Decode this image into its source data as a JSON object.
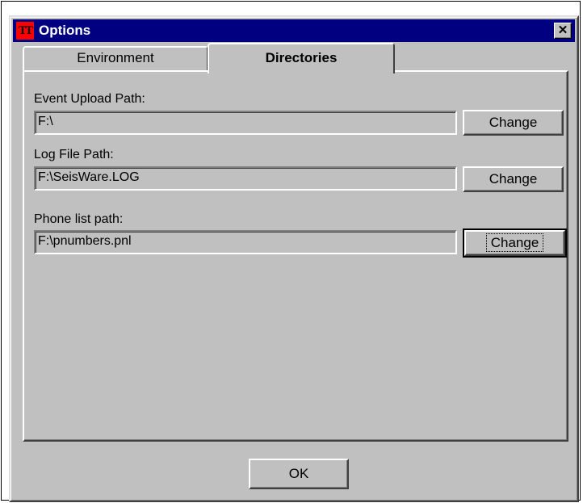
{
  "window": {
    "title": "Options",
    "icon_text": "TT",
    "close_glyph": "✕"
  },
  "tabs": [
    {
      "label": "Environment",
      "active": false
    },
    {
      "label": "Directories",
      "active": true
    }
  ],
  "directories": {
    "fields": [
      {
        "label": "Event Upload Path:",
        "value": "F:\\",
        "button": "Change"
      },
      {
        "label": "Log File Path:",
        "value": "F:\\SeisWare.LOG",
        "button": "Change"
      },
      {
        "label": "Phone list path:",
        "value": "F:\\pnumbers.pnl",
        "button": "Change",
        "focused": true
      }
    ]
  },
  "footer": {
    "ok_label": "OK"
  },
  "colors": {
    "titlebar": "#000080",
    "face": "#c0c0c0",
    "icon": "#ff0000"
  }
}
